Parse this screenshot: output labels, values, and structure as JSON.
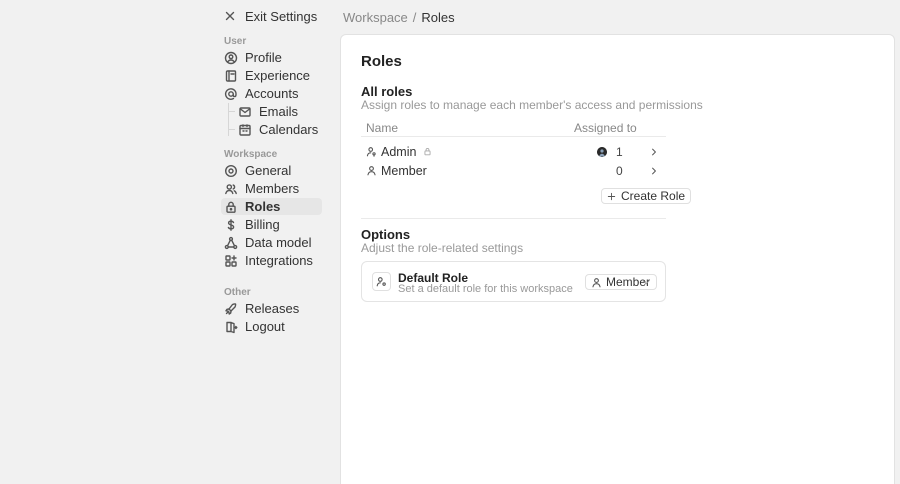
{
  "exit": {
    "label": "Exit Settings",
    "icon": "close-icon"
  },
  "sidebar": {
    "user_label": "User",
    "workspace_label": "Workspace",
    "other_label": "Other",
    "user_items": [
      {
        "label": "Profile",
        "icon": "user-circle-icon"
      },
      {
        "label": "Experience",
        "icon": "book-icon"
      },
      {
        "label": "Accounts",
        "icon": "at-sign-icon"
      }
    ],
    "account_subitems": [
      {
        "label": "Emails",
        "icon": "mail-icon"
      },
      {
        "label": "Calendars",
        "icon": "calendar-icon"
      }
    ],
    "workspace_items": [
      {
        "label": "General",
        "icon": "settings-icon"
      },
      {
        "label": "Members",
        "icon": "users-icon"
      },
      {
        "label": "Roles",
        "icon": "lock-icon"
      },
      {
        "label": "Billing",
        "icon": "dollar-icon"
      },
      {
        "label": "Data model",
        "icon": "hierarchy-icon"
      },
      {
        "label": "Integrations",
        "icon": "apps-icon"
      }
    ],
    "other_items": [
      {
        "label": "Releases",
        "icon": "rocket-icon"
      },
      {
        "label": "Logout",
        "icon": "logout-icon"
      }
    ]
  },
  "breadcrumb": {
    "parent": "Workspace",
    "separator": "/",
    "current": "Roles"
  },
  "main": {
    "title": "Roles",
    "all_roles": {
      "heading": "All roles",
      "description": "Assign roles to manage each member's access and permissions",
      "columns": [
        "Name",
        "Assigned to"
      ],
      "rows": [
        {
          "name": "Admin",
          "count": "1",
          "locked": true,
          "has_avatar": true
        },
        {
          "name": "Member",
          "count": "0",
          "locked": false,
          "has_avatar": false
        }
      ],
      "create_label": "Create Role"
    },
    "options": {
      "heading": "Options",
      "description": "Adjust the role-related settings",
      "default_role": {
        "title": "Default Role",
        "description": "Set a default role for this workspace",
        "value": "Member"
      }
    }
  }
}
